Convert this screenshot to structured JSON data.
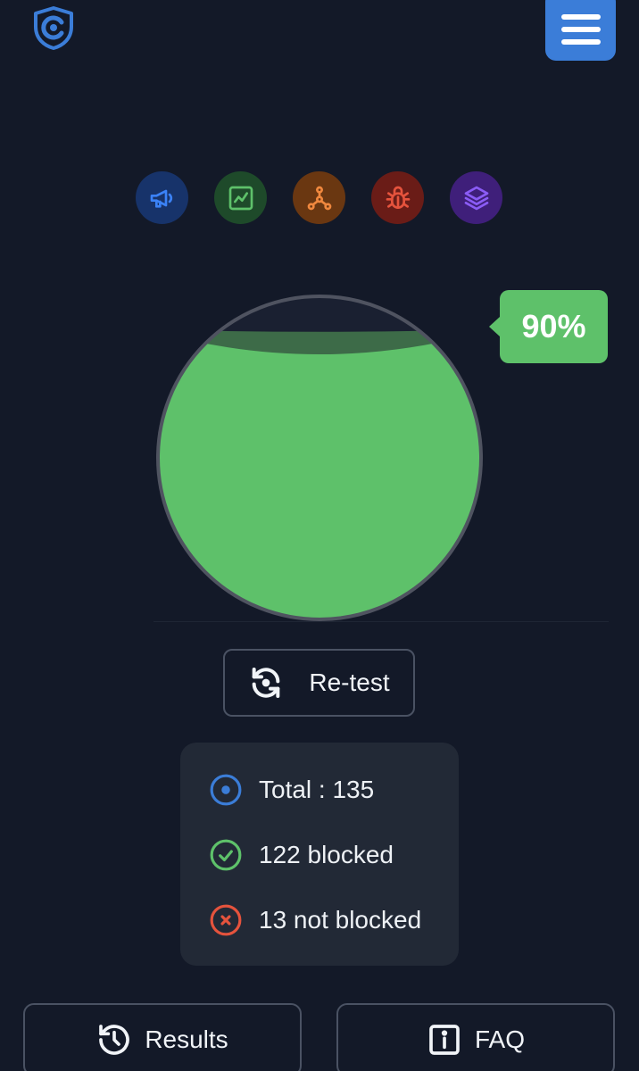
{
  "header": {
    "logo_icon": "shield-logo-icon",
    "menu_icon": "hamburger-menu-icon",
    "accent_color": "#3b7dd8"
  },
  "categories": [
    {
      "icon": "megaphone-icon",
      "color": "#3b7dd8"
    },
    {
      "icon": "chart-icon",
      "color": "#5ec16a"
    },
    {
      "icon": "network-nodes-icon",
      "color": "#f0883e"
    },
    {
      "icon": "bug-icon",
      "color": "#e5533d"
    },
    {
      "icon": "layers-icon",
      "color": "#8b5cf6"
    }
  ],
  "gauge": {
    "percent_label": "90%",
    "fill_fraction": 0.9,
    "fill_color": "#5ec16a"
  },
  "actions": {
    "retest_label": "Re-test"
  },
  "summary": {
    "total_label": "Total : 135",
    "blocked_label": "122 blocked",
    "not_blocked_label": "13 not blocked"
  },
  "bottom": {
    "results_label": "Results",
    "faq_label": "FAQ"
  }
}
